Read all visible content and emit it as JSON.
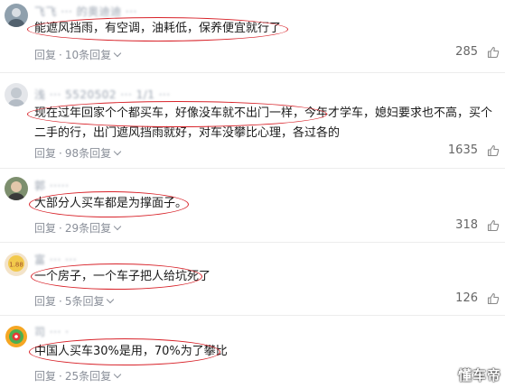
{
  "comments": [
    {
      "username": "飞飞 ··· 的奥迪迪 ···",
      "text": "能遮风挡雨，有空调，油耗低，保养便宜就行了",
      "reply_label": "回复",
      "separator": "·",
      "replies_label": "10条回复",
      "likes": "285"
    },
    {
      "username": "浅 ··· 5520502 ··· 1/1 ···",
      "text": "现在过年回家个个都买车，好像没车就不出门一样，今年才学车，媳妇要求也不高，买个二手的行，出门遮风挡雨就好，对车没攀比心理，各过各的",
      "reply_label": "回复",
      "separator": "·",
      "replies_label": "98条回复",
      "likes": "1635"
    },
    {
      "username": "郭 ·····",
      "text": "大部分人买车都是为撑面子。",
      "reply_label": "回复",
      "separator": "·",
      "replies_label": "29条回复",
      "likes": "318"
    },
    {
      "username": "富 ··· ···",
      "text": "一个房子，一个车子把人给坑死了",
      "reply_label": "回复",
      "separator": "·",
      "replies_label": "5条回复",
      "likes": "126"
    },
    {
      "username": "司 ··· ·",
      "text": "中国人买车30%是用，70%为了攀比",
      "reply_label": "回复",
      "separator": "·",
      "replies_label": "25条回复",
      "likes": ""
    }
  ],
  "watermark": "懂车帝",
  "colors": {
    "annotation_oval": "#d8232a",
    "meta_text": "#8a8f99",
    "divider": "#ececec"
  },
  "icons": {
    "like": "thumbs-up-icon",
    "expand": "chevron-down-icon"
  }
}
